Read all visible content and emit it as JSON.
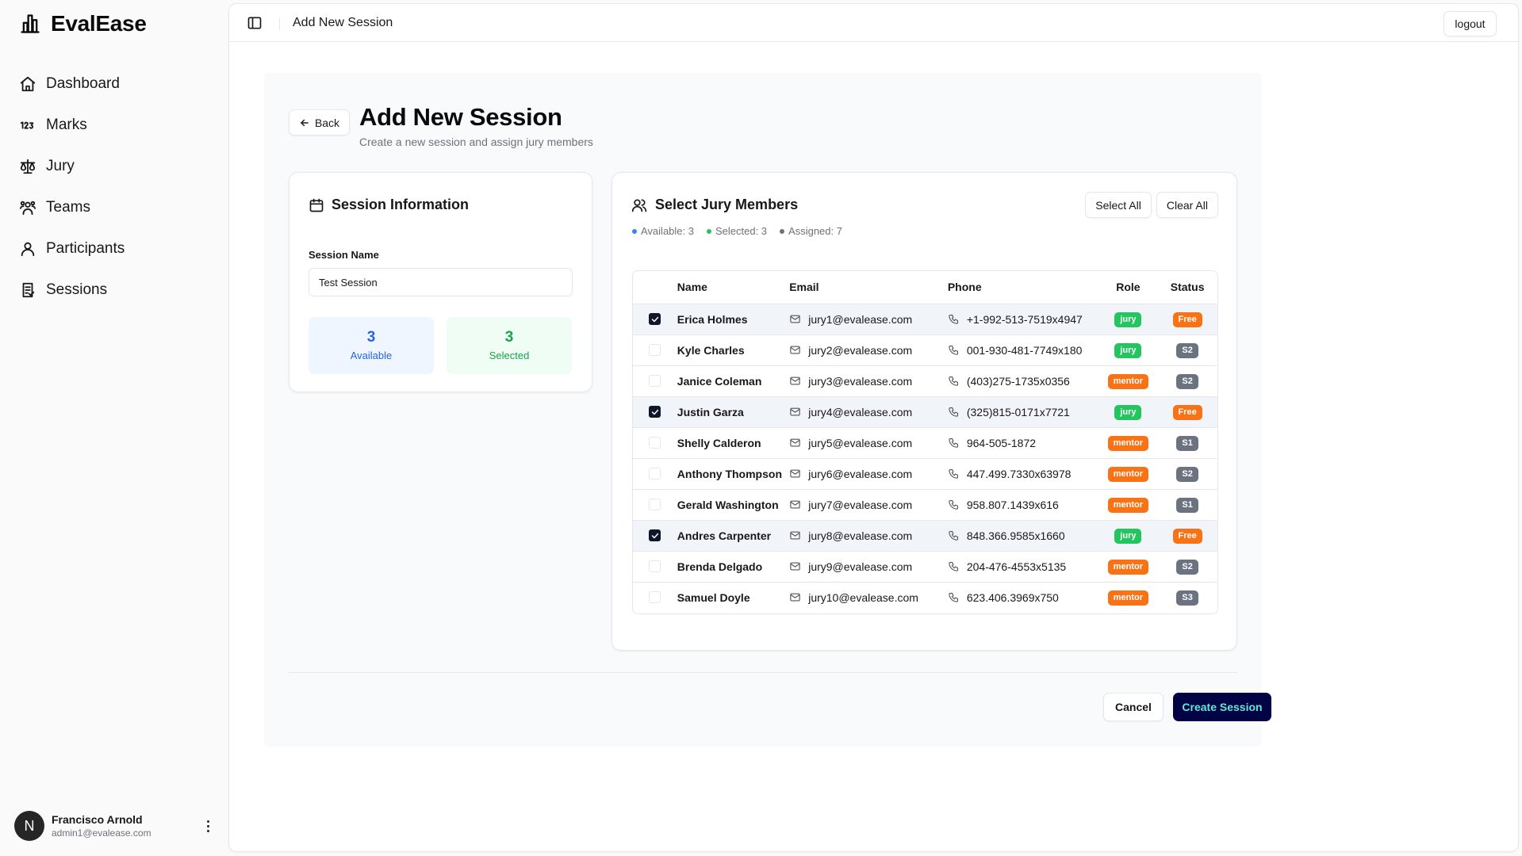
{
  "app": {
    "name": "EvalEase"
  },
  "sidebar": {
    "items": [
      {
        "label": "Dashboard",
        "icon": "house-icon"
      },
      {
        "label": "Marks",
        "icon": "numbers-123-icon"
      },
      {
        "label": "Jury",
        "icon": "scale-icon"
      },
      {
        "label": "Teams",
        "icon": "users-group-icon"
      },
      {
        "label": "Participants",
        "icon": "user-icon"
      },
      {
        "label": "Sessions",
        "icon": "clipboard-list-icon"
      }
    ],
    "user": {
      "initial": "N",
      "name": "Francisco Arnold",
      "email": "admin1@evalease.com"
    }
  },
  "topbar": {
    "title": "Add New Session",
    "logout_label": "logout"
  },
  "page": {
    "back_label": "Back",
    "title": "Add New Session",
    "subtitle": "Create a new session and assign jury members"
  },
  "session_info": {
    "title": "Session Information",
    "name_label": "Session Name",
    "name_value": "Test Session",
    "available_count": "3",
    "available_label": "Available",
    "selected_count": "3",
    "selected_label": "Selected"
  },
  "jury": {
    "title": "Select Jury Members",
    "counts": {
      "available": "Available: 3",
      "selected": "Selected: 3",
      "assigned": "Assigned: 7"
    },
    "select_all_label": "Select All",
    "clear_all_label": "Clear All",
    "columns": {
      "name": "Name",
      "email": "Email",
      "phone": "Phone",
      "role": "Role",
      "status": "Status"
    },
    "rows": [
      {
        "selected": true,
        "name": "Erica Holmes",
        "email": "jury1@evalease.com",
        "phone": "+1-992-513-7519x4947",
        "role": "jury",
        "status": "Free"
      },
      {
        "selected": false,
        "name": "Kyle Charles",
        "email": "jury2@evalease.com",
        "phone": "001-930-481-7749x180",
        "role": "jury",
        "status": "S2"
      },
      {
        "selected": false,
        "name": "Janice Coleman",
        "email": "jury3@evalease.com",
        "phone": "(403)275-1735x0356",
        "role": "mentor",
        "status": "S2"
      },
      {
        "selected": true,
        "name": "Justin Garza",
        "email": "jury4@evalease.com",
        "phone": "(325)815-0171x7721",
        "role": "jury",
        "status": "Free"
      },
      {
        "selected": false,
        "name": "Shelly Calderon",
        "email": "jury5@evalease.com",
        "phone": "964-505-1872",
        "role": "mentor",
        "status": "S1"
      },
      {
        "selected": false,
        "name": "Anthony Thompson",
        "email": "jury6@evalease.com",
        "phone": "447.499.7330x63978",
        "role": "mentor",
        "status": "S2"
      },
      {
        "selected": false,
        "name": "Gerald Washington",
        "email": "jury7@evalease.com",
        "phone": "958.807.1439x616",
        "role": "mentor",
        "status": "S1"
      },
      {
        "selected": true,
        "name": "Andres Carpenter",
        "email": "jury8@evalease.com",
        "phone": "848.366.9585x1660",
        "role": "jury",
        "status": "Free"
      },
      {
        "selected": false,
        "name": "Brenda Delgado",
        "email": "jury9@evalease.com",
        "phone": "204-476-4553x5135",
        "role": "mentor",
        "status": "S2"
      },
      {
        "selected": false,
        "name": "Samuel Doyle",
        "email": "jury10@evalease.com",
        "phone": "623.406.3969x750",
        "role": "mentor",
        "status": "S3"
      }
    ]
  },
  "footer": {
    "cancel_label": "Cancel",
    "create_label": "Create Session"
  },
  "colors": {
    "primary_button": "#020344",
    "primary_button_text": "#5eead4",
    "jury_badge": "#22c55e",
    "mentor_badge": "#f97316",
    "free_badge": "#f97316",
    "slot_badge": "#6b7280",
    "available_accent": "#2563eb",
    "selected_accent": "#16a34a"
  }
}
